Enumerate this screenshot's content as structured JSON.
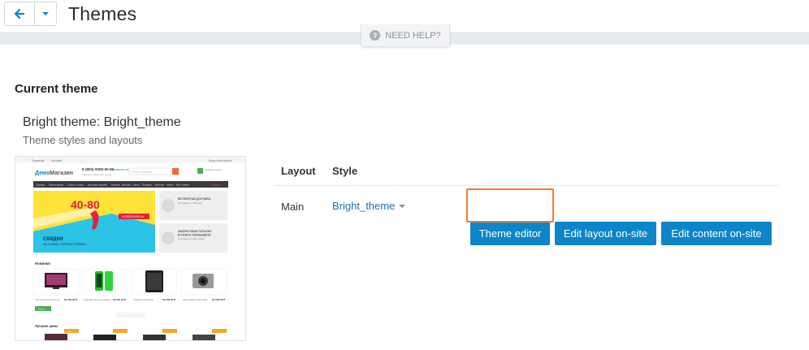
{
  "header": {
    "title": "Themes",
    "back_icon": "arrow-left-icon",
    "dropdown_icon": "caret-down-icon",
    "help_label": "NEED HELP?"
  },
  "current_theme": {
    "section_title": "Current theme",
    "name": "Bright theme: Bright_theme",
    "subtitle": "Theme styles and layouts",
    "preview": {
      "top_strip": [
        "Приветики",
        "Контакты",
        "Вход в мой кабинет"
      ],
      "logo_part1": "Демо",
      "logo_part2": "Магазин",
      "phone": "8 (800) 0000-00-00",
      "phone_note": "Заказать обратный звонок",
      "callback": "Перезвоните мне",
      "search_placeholder": "Поиск по магазину",
      "cart_label": "Корзина пуста",
      "menu": [
        "Одежда",
        "Электроника",
        "Спорт и отдых",
        "Бытовая техника",
        "Музыка",
        "Фильмы",
        "Книги",
        "Подарки",
        "Бренды",
        "Акции",
        "Все товары",
        "Скидки"
      ],
      "banner_number": "40-80",
      "banner_button": "УСПЕЙ КУПИТЬ!",
      "banner_text1": "СКИДКИ",
      "banner_text2": "НА САМЫЕ ГОРЯЧИЕ ТОВАРЫ",
      "side1_title": "БЕСПЛАТНАЯ ДОСТАВКА",
      "side1_text": "при заказе от 3000 руб.",
      "side2_title": "ЗАБЕРИ СВОЮ ПОСЫЛКУ",
      "side2_title2": "В ПУНКТЕ САМОВЫВОЗА",
      "side2_text": "в удобное для вас время",
      "novelties_title": "Новинки",
      "products": [
        {
          "name": "LCD телевизор Samsung",
          "price": "$1,400.00 ₽"
        },
        {
          "name": "Смартфон Samsung Galaxy",
          "price": "$1,000.00 ₽"
        },
        {
          "name": "Планшет Apple iPad",
          "price": "$1,000.00 ₽"
        },
        {
          "name": "Экшн-камера GoPro Hero",
          "price": "$1,000.00 ₽"
        }
      ],
      "buy_label": "Купить",
      "bestsellers_title": "Лучшие цены",
      "badge": "Хит!"
    }
  },
  "table": {
    "headers": {
      "layout": "Layout",
      "style": "Style"
    },
    "rows": [
      {
        "layout": "Main",
        "style": "Bright_theme"
      }
    ]
  },
  "actions": {
    "theme_editor": "Theme editor",
    "edit_layout": "Edit layout on-site",
    "edit_content": "Edit content on-site"
  },
  "colors": {
    "primary": "#0d85c8",
    "highlight": "#f07d2b",
    "link": "#1a72ad"
  }
}
